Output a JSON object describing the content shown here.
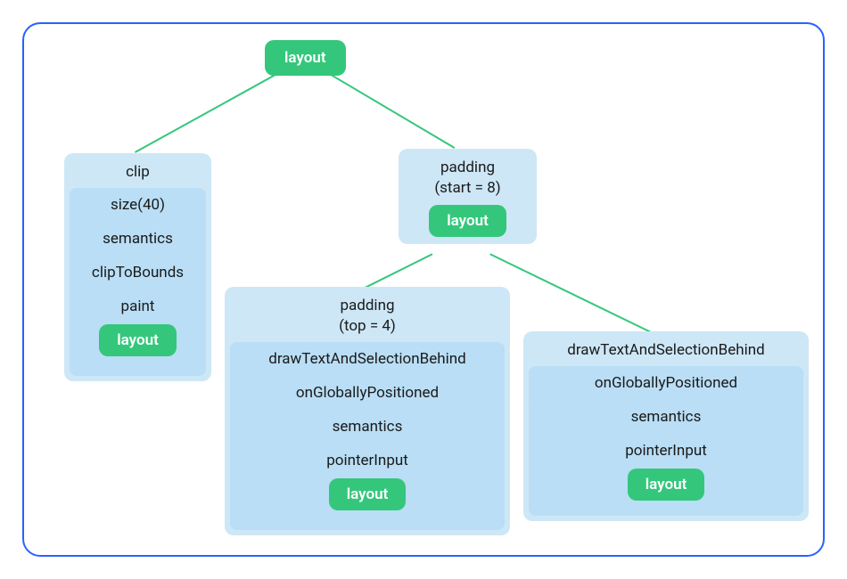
{
  "root": {
    "label": "layout"
  },
  "left": {
    "l0": "clip",
    "l1": "size(40)",
    "l2": "semantics",
    "l3": "clipToBounds",
    "l4": "paint",
    "leaf": "layout"
  },
  "right": {
    "l0": "padding\n(start = 8)",
    "leaf": "layout"
  },
  "bottomLeft": {
    "l0": "padding\n(top = 4)",
    "l1": "drawTextAndSelectionBehind",
    "l2": "onGloballyPositioned",
    "l3": "semantics",
    "l4": "pointerInput",
    "leaf": "layout"
  },
  "bottomRight": {
    "l0": "drawTextAndSelectionBehind",
    "l1": "onGloballyPositioned",
    "l2": "semantics",
    "l3": "pointerInput",
    "leaf": "layout"
  }
}
